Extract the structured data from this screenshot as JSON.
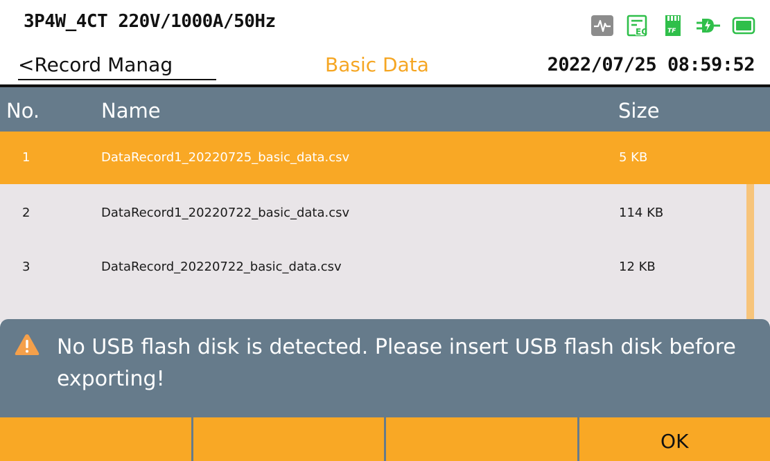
{
  "status": {
    "config": "3P4W_4CT 220V/1000A/50Hz",
    "icons": [
      "waveform-icon",
      "record-icon",
      "tf-card-icon",
      "power-plug-icon",
      "battery-icon"
    ],
    "tf_label": "TF"
  },
  "header": {
    "back_label": "<Record Manag",
    "title": "Basic Data",
    "datetime": "2022/07/25 08:59:52"
  },
  "table": {
    "columns": {
      "no": "No.",
      "name": "Name",
      "size": "Size"
    },
    "rows": [
      {
        "no": "1",
        "name": "DataRecord1_20220725_basic_data.csv",
        "size": "5 KB",
        "selected": true
      },
      {
        "no": "2",
        "name": "DataRecord1_20220722_basic_data.csv",
        "size": "114 KB",
        "selected": false
      },
      {
        "no": "3",
        "name": "DataRecord_20220722_basic_data.csv",
        "size": "12 KB",
        "selected": false
      }
    ]
  },
  "alert": {
    "message": "No USB flash disk is detected. Please insert USB flash disk before exporting!"
  },
  "softkeys": [
    "",
    "",
    "",
    "OK"
  ],
  "colors": {
    "accent": "#f9a825",
    "header_bg": "#667b8b",
    "list_bg": "#e9e5e8",
    "title_orange": "#f5a623",
    "status_green": "#2fbf4a"
  }
}
